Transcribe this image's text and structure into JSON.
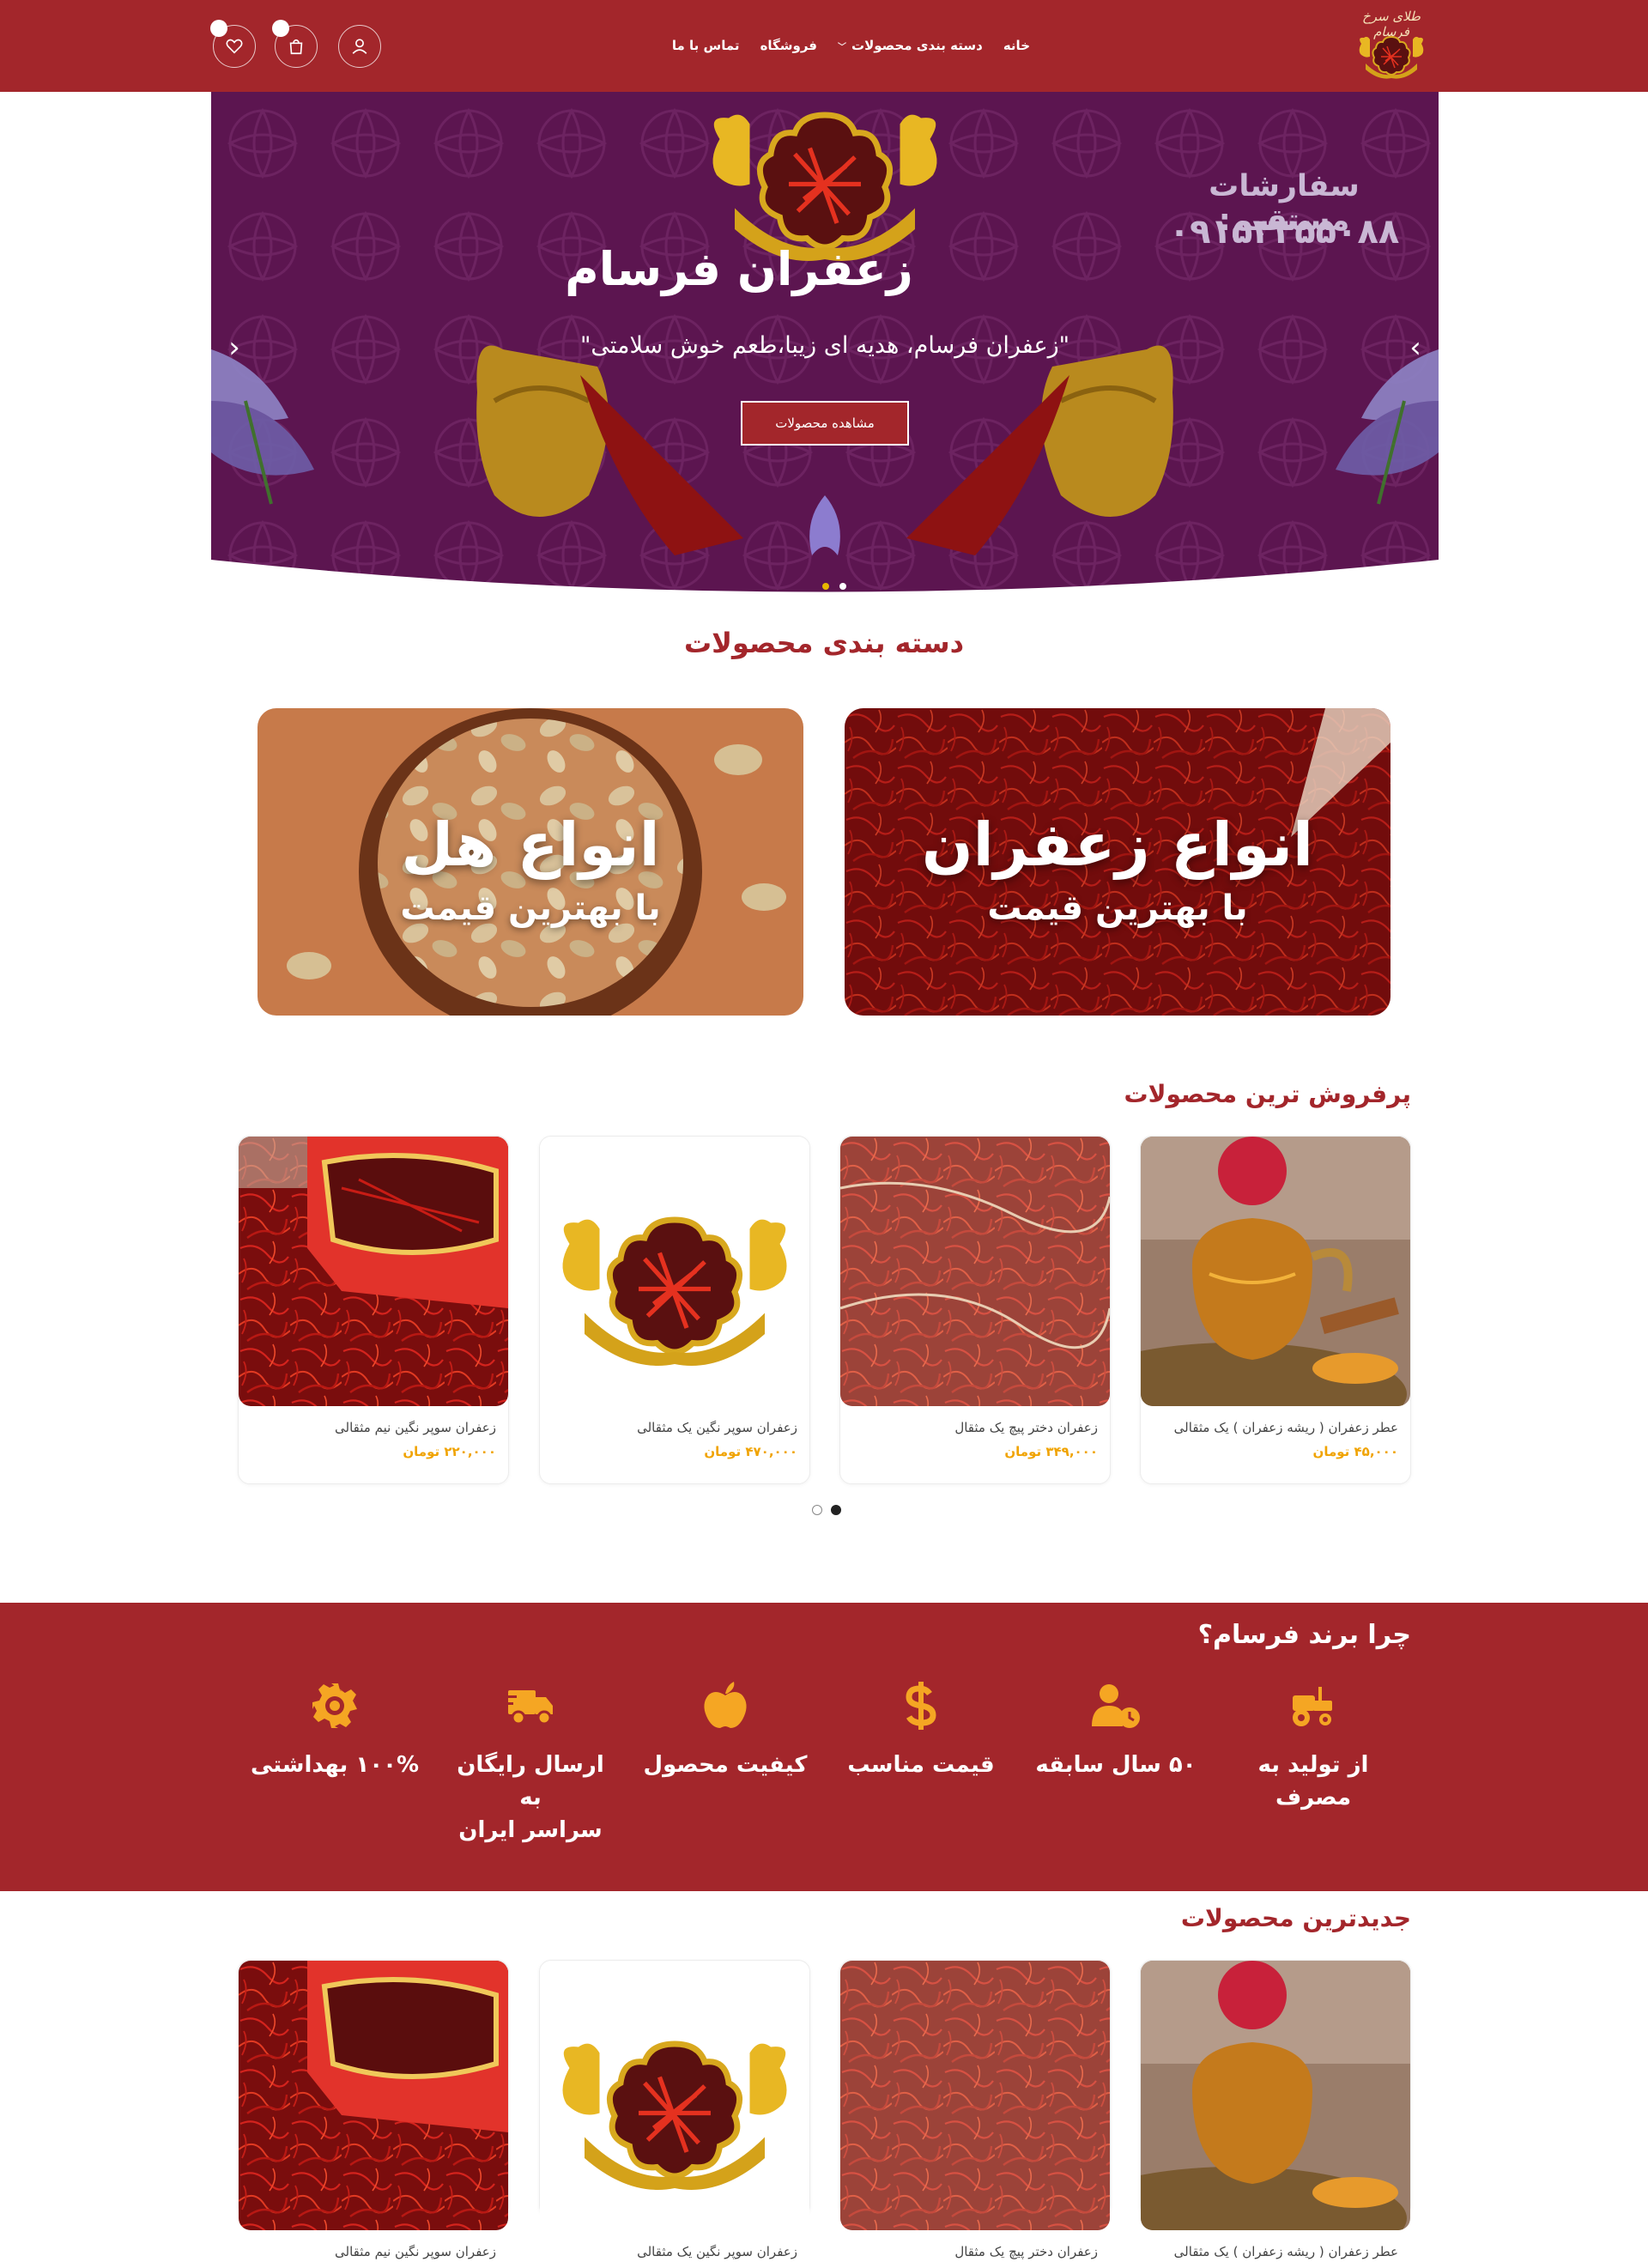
{
  "header": {
    "logo_text": "طلای سرخ فرسام",
    "nav": [
      {
        "label": "خانه"
      },
      {
        "label": "دسته بندی محصولات",
        "has_dropdown": true
      },
      {
        "label": "فروشگاه"
      },
      {
        "label": "تماس با ما"
      }
    ],
    "icons": {
      "user": "user-icon",
      "cart": "cart-icon",
      "wishlist": "heart-icon"
    },
    "cart_count": "",
    "wishlist_count": ""
  },
  "hero": {
    "title": "زعفران فرسام",
    "subtitle": "\"زعفران فرسام، هدیه ای زیبا،طعم خوش سلامتی\"",
    "button": "مشاهده محصولات",
    "order_label": "سفارشات مستقیم:",
    "phone": "۰۹۱۵۳۳۵۵۰۸۸",
    "slides": 2,
    "active_slide": 0,
    "colors": {
      "bg": "#5e1450",
      "accent": "#a3262b"
    }
  },
  "categories": {
    "title": "دسته بندی محصولات",
    "items": [
      {
        "main": "انواع زعفران",
        "sub": "با بهترین قیمت"
      },
      {
        "main": "انواع هل",
        "sub": "با بهترین قیمت"
      }
    ]
  },
  "best_sellers": {
    "title": "پرفروش ترین محصولات",
    "products": [
      {
        "name": "عطر زعفران ( ریشه زعفران ) یک مثقالی",
        "price": "۴۵,۰۰۰ تومان"
      },
      {
        "name": "زعفران دختر پیچ یک مثقال",
        "price": "۳۴۹,۰۰۰ تومان"
      },
      {
        "name": "زعفران سوپر نگین یک مثقالی",
        "price": "۴۷۰,۰۰۰ تومان"
      },
      {
        "name": "زعفران سوپر نگین نیم مثقالی",
        "price": "۲۲۰,۰۰۰ تومان"
      }
    ],
    "pages": 2,
    "active_page": 1
  },
  "why": {
    "title": "چرا برند فرسام؟",
    "features": [
      {
        "label": "از تولید به\nمصرف",
        "icon": "tractor-icon"
      },
      {
        "label": "۵۰ سال سابقه",
        "icon": "user-clock-icon"
      },
      {
        "label": "قیمت مناسب",
        "icon": "dollar-icon"
      },
      {
        "label": "کیفیت محصول",
        "icon": "apple-icon"
      },
      {
        "label": "ارسال رایگان به\nسراسر ایران",
        "icon": "truck-icon"
      },
      {
        "label": "۱۰۰% بهداشتی",
        "icon": "gear-icon"
      }
    ],
    "icon_color": "#f5a623"
  },
  "newest": {
    "title": "جدیدترین محصولات",
    "products": [
      {
        "name": "عطر زعفران ( ریشه زعفران ) یک مثقالی"
      },
      {
        "name": "زعفران دختر پیچ یک مثقال"
      },
      {
        "name": "زعفران سوپر نگین یک مثقالی"
      },
      {
        "name": "زعفران سوپر نگین نیم مثقالی"
      }
    ]
  }
}
